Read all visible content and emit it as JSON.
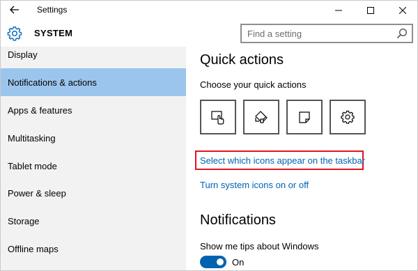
{
  "window": {
    "title": "Settings"
  },
  "header": {
    "section": "SYSTEM",
    "search_placeholder": "Find a setting"
  },
  "sidebar": {
    "items": [
      {
        "label": "Display",
        "active": false
      },
      {
        "label": "Notifications & actions",
        "active": true
      },
      {
        "label": "Apps & features",
        "active": false
      },
      {
        "label": "Multitasking",
        "active": false
      },
      {
        "label": "Tablet mode",
        "active": false
      },
      {
        "label": "Power & sleep",
        "active": false
      },
      {
        "label": "Storage",
        "active": false
      },
      {
        "label": "Offline maps",
        "active": false
      }
    ]
  },
  "main": {
    "quick_actions_heading": "Quick actions",
    "quick_actions_sub": "Choose your quick actions",
    "quick_action_icons": [
      "tablet-mode-icon",
      "note-edit-icon",
      "note-icon",
      "gear-icon"
    ],
    "link_taskbar_icons": "Select which icons appear on the taskbar",
    "link_system_icons": "Turn system icons on or off",
    "notifications_heading": "Notifications",
    "tips_label": "Show me tips about Windows",
    "tips_toggle_state": "On"
  },
  "colors": {
    "accent": "#0063b1",
    "selected_nav": "#9bc5ec",
    "highlight": "#e0141f",
    "sidebar_bg": "#f2f2f2"
  }
}
